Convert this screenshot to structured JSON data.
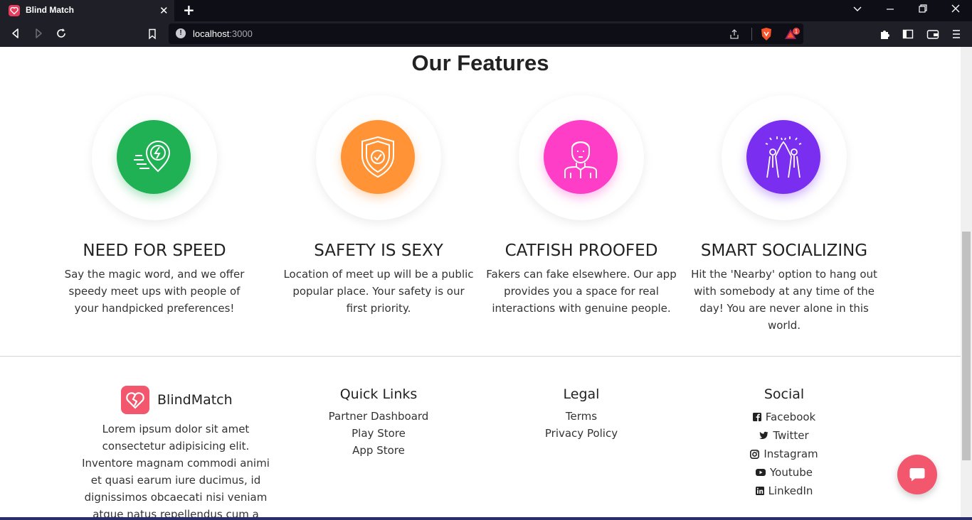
{
  "browser": {
    "tab_title": "Blind Match",
    "tab_close": "✕",
    "new_tab": "+",
    "url_host": "localhost",
    "url_port": ":3000",
    "controls": {
      "dropdown": "⌄",
      "minimize": "—",
      "restore": "❐",
      "close": "✕"
    },
    "brave_badge": "1"
  },
  "features": {
    "title": "Our Features",
    "items": [
      {
        "title": "NEED FOR SPEED",
        "description": "Say the magic word, and we offer speedy meet ups with people of your handpicked preferences!",
        "color": "#1fb153",
        "icon": "lightning-location-icon"
      },
      {
        "title": "SAFETY IS SEXY",
        "description": "Location of meet up will be a public popular place. Your safety is our first priority.",
        "color": "#ff9336",
        "icon": "shield-check-icon"
      },
      {
        "title": "CATFISH PROOFED",
        "description": "Fakers can fake elsewhere. Our app provides you a space for real interactions with genuine people.",
        "color": "#ff3ec8",
        "icon": "person-icon"
      },
      {
        "title": "SMART SOCIALIZING",
        "description": "Hit the 'Nearby' option to hang out with somebody at any time of the day! You are never alone in this world.",
        "color": "#7a2ff0",
        "icon": "high-five-icon"
      }
    ]
  },
  "footer": {
    "brand_name": "BlindMatch",
    "brand_text": "Lorem ipsum dolor sit amet consectetur adipisicing elit. Inventore magnam commodi animi et quasi earum iure ducimus, id dignissimos obcaecati nisi veniam atque natus repellendus cum a",
    "quick_links": {
      "title": "Quick Links",
      "items": [
        "Partner Dashboard",
        "Play Store",
        "App Store"
      ]
    },
    "legal": {
      "title": "Legal",
      "items": [
        "Terms",
        "Privacy Policy"
      ]
    },
    "social": {
      "title": "Social",
      "items": [
        "Facebook",
        "Twitter",
        "Instagram",
        "Youtube",
        "LinkedIn"
      ]
    }
  },
  "colors": {
    "brand": "#f2576e",
    "browser_dark": "#1f2027"
  }
}
